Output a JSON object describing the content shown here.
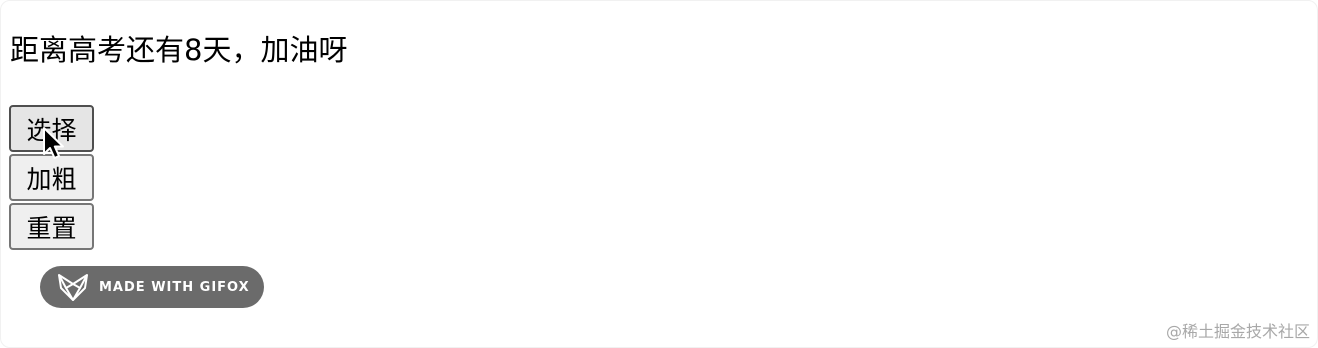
{
  "heading": "距离高考还有8天，加油呀",
  "buttons": {
    "select": "选择",
    "bold": "加粗",
    "reset": "重置"
  },
  "badge": {
    "text": "MADE WITH GIFOX",
    "icon": "fox-logo-icon"
  },
  "watermark": "@稀土掘金技术社区",
  "colors": {
    "badge_bg": "#6b6b6b",
    "button_bg": "#efefef",
    "button_border": "#767676",
    "watermark": "#a8a8a8"
  }
}
